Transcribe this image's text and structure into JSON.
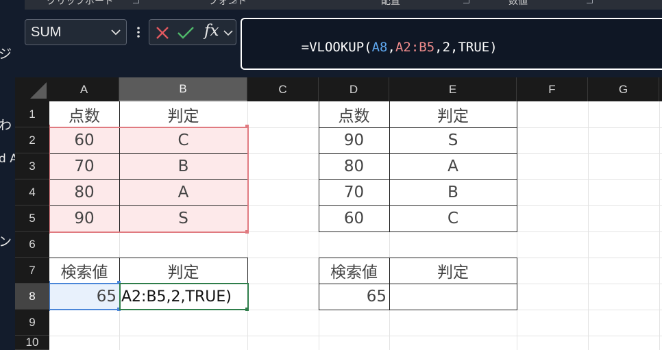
{
  "ribbon": {
    "groups": [
      "クリップボード",
      "フォント",
      "配置",
      "数値"
    ]
  },
  "left_pane": {
    "fragments": [
      "ジ",
      "わ",
      "d A",
      "ン"
    ]
  },
  "namebox": {
    "value": "SUM"
  },
  "formula_bar": {
    "fx_label": "fx",
    "segments": [
      {
        "text": "=VLOOKUP(",
        "color": "#ffffff"
      },
      {
        "text": "A8",
        "color": "#5fa8f0"
      },
      {
        "text": ",",
        "color": "#ffffff"
      },
      {
        "text": "A2:B5",
        "color": "#f08c8c"
      },
      {
        "text": ",2,TRUE)",
        "color": "#ffffff"
      }
    ]
  },
  "columns": [
    "A",
    "B",
    "C",
    "D",
    "E",
    "F",
    "G"
  ],
  "rows": [
    "1",
    "2",
    "3",
    "4",
    "5",
    "6",
    "7",
    "8",
    "9",
    "10"
  ],
  "table1": {
    "header": [
      "点数",
      "判定"
    ],
    "rows": [
      [
        "60",
        "C"
      ],
      [
        "70",
        "B"
      ],
      [
        "80",
        "A"
      ],
      [
        "90",
        "S"
      ]
    ],
    "lookup_label": "検索値",
    "result_label": "判定",
    "lookup_value": "65",
    "editing_text": "A2:B5,2,TRUE)"
  },
  "table2": {
    "header": [
      "点数",
      "判定"
    ],
    "rows": [
      [
        "90",
        "S"
      ],
      [
        "80",
        "A"
      ],
      [
        "70",
        "B"
      ],
      [
        "60",
        "C"
      ]
    ],
    "lookup_label": "検索値",
    "result_label": "判定",
    "lookup_value": "65",
    "result_value": ""
  },
  "colors": {
    "app_bg": "#131c2c",
    "range_ref": "#e07a80",
    "cell_ref": "#4a86d8",
    "active_cell": "#2e7d4a"
  }
}
